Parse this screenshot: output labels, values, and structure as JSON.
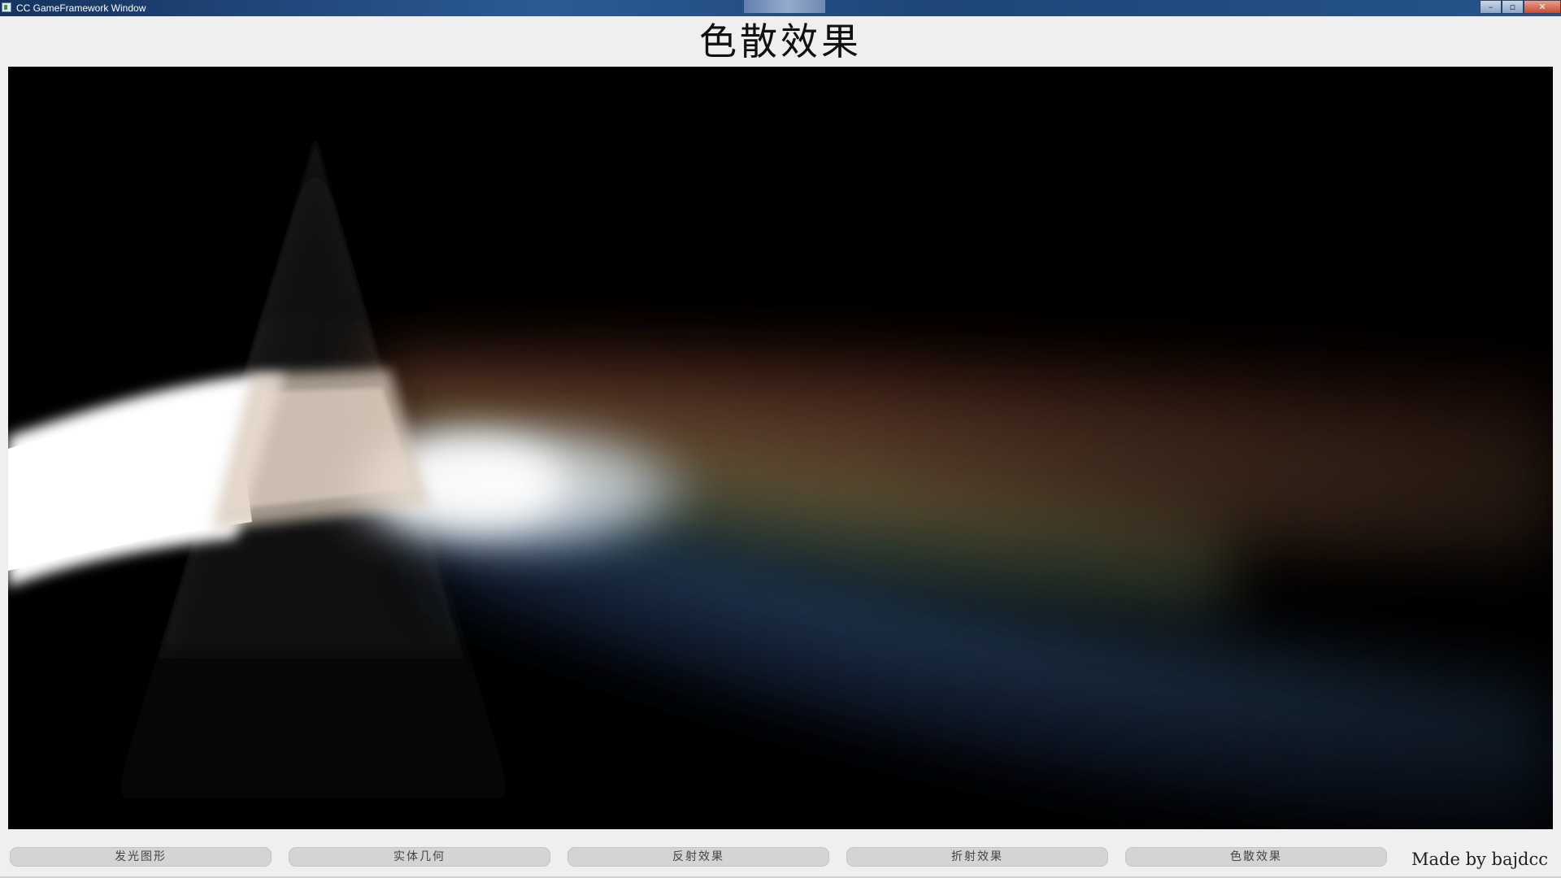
{
  "window": {
    "title": "CC GameFramework Window",
    "controls": {
      "minimize": "–",
      "maximize": "▫",
      "close": "✕"
    }
  },
  "header": {
    "title": "色散效果"
  },
  "canvas": {
    "background": "#000000",
    "scene": "prism-dispersion"
  },
  "buttons": [
    {
      "label": "发光图形"
    },
    {
      "label": "实体几何"
    },
    {
      "label": "反射效果"
    },
    {
      "label": "折射效果"
    },
    {
      "label": "色散效果"
    }
  ],
  "footer": {
    "credit": "Made by bajdcc"
  },
  "colors": {
    "titlebar": "#1e4678",
    "panel_background": "#efefef",
    "button_background": "#d4d4d4"
  }
}
